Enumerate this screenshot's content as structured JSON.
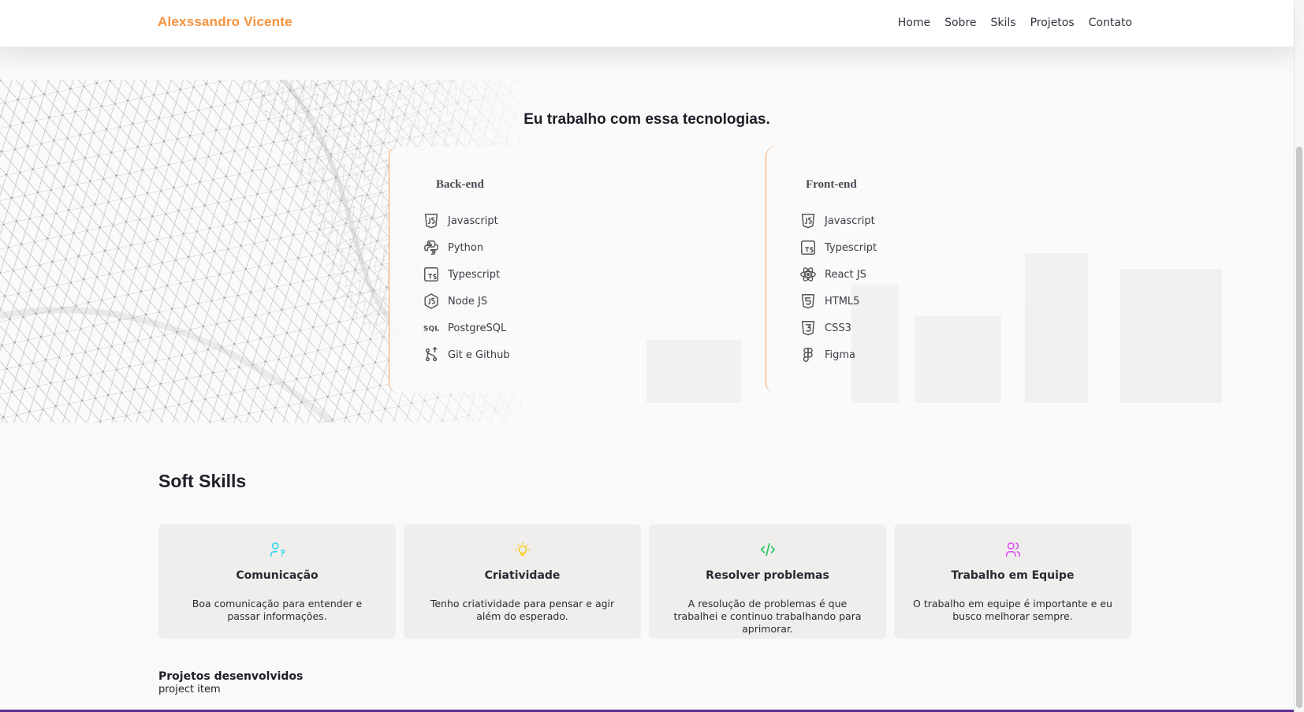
{
  "nav": {
    "brand": "Alexssandro Vicente",
    "links": [
      "Home",
      "Sobre",
      "Skils",
      "Projetos",
      "Contato"
    ]
  },
  "tech": {
    "title": "Eu trabalho com essa tecnologias.",
    "backend": {
      "heading": "Back-end",
      "items": [
        {
          "label": "Javascript",
          "icon": "javascript-icon"
        },
        {
          "label": "Python",
          "icon": "python-icon"
        },
        {
          "label": "Typescript",
          "icon": "typescript-icon"
        },
        {
          "label": "Node JS",
          "icon": "nodejs-icon"
        },
        {
          "label": "PostgreSQL",
          "icon": "sql-icon"
        },
        {
          "label": "Git e Github",
          "icon": "git-branch-icon"
        }
      ]
    },
    "frontend": {
      "heading": "Front-end",
      "items": [
        {
          "label": "Javascript",
          "icon": "javascript-icon"
        },
        {
          "label": "Typescript",
          "icon": "typescript-icon"
        },
        {
          "label": "React JS",
          "icon": "react-icon"
        },
        {
          "label": "HTML5",
          "icon": "html5-icon"
        },
        {
          "label": "CSS3",
          "icon": "css3-icon"
        },
        {
          "label": "Figma",
          "icon": "figma-icon"
        }
      ]
    }
  },
  "soft": {
    "title": "Soft Skills",
    "cards": [
      {
        "name": "Comunicação",
        "desc": "Boa comunicação para entender e passar informações.",
        "icon": "user-question-icon",
        "color": "#22d3ee"
      },
      {
        "name": "Criatividade",
        "desc": "Tenho criatividade para pensar e agir além do esperado.",
        "icon": "bulb-icon",
        "color": "#facc15"
      },
      {
        "name": "Resolver problemas",
        "desc": "A resolução de problemas é que trabalhei e continuo trabalhando para aprimorar.",
        "icon": "code-icon",
        "color": "#22c55e"
      },
      {
        "name": "Trabalho em Equipe",
        "desc": "O trabalho em equipe é importante e eu busco melhorar sempre.",
        "icon": "users-icon",
        "color": "#d946ef"
      }
    ]
  },
  "projects": {
    "title": "Projetos desenvolvidos",
    "item": "project item"
  },
  "colors": {
    "accent": "#f5923e",
    "card_border": "#f5a262",
    "bottom_bar": "#5b2d8e"
  }
}
